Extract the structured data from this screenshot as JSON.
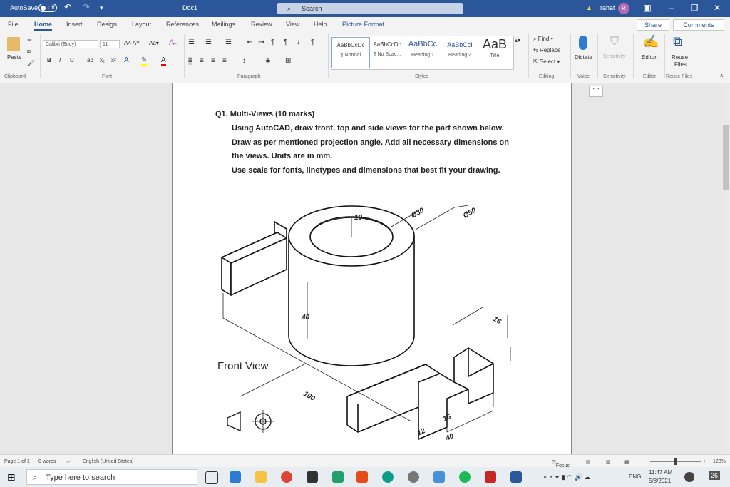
{
  "titlebar": {
    "autosave_label": "AutoSave",
    "autosave_state": "Off",
    "doc_title": "Doc1",
    "search_placeholder": "Search",
    "user_name": "rahaf",
    "user_initial": "R"
  },
  "tabs": [
    "File",
    "Home",
    "Insert",
    "Design",
    "Layout",
    "References",
    "Mailings",
    "Review",
    "View",
    "Help",
    "Picture Format"
  ],
  "share_label": "Share",
  "comments_label": "Comments",
  "ribbon": {
    "clipboard": {
      "paste": "Paste",
      "label": "Clipboard"
    },
    "font": {
      "name": "Calibri (Body)",
      "size": "11",
      "label": "Font",
      "bold": "B",
      "italic": "I",
      "underline": "U"
    },
    "paragraph": {
      "label": "Paragraph"
    },
    "styles": {
      "label": "Styles",
      "items": [
        {
          "preview": "AaBbCcDc",
          "name": "¶ Normal"
        },
        {
          "preview": "AaBbCcDc",
          "name": "¶ No Spac..."
        },
        {
          "preview": "AaBbCc",
          "name": "Heading 1"
        },
        {
          "preview": "AaBbCcI",
          "name": "Heading 2"
        },
        {
          "preview": "AaB",
          "name": "Title"
        }
      ]
    },
    "editing": {
      "find": "Find",
      "replace": "Replace",
      "select": "Select",
      "label": "Editing"
    },
    "voice": {
      "dictate": "Dictate",
      "label": "Voice"
    },
    "sensitivity": {
      "btn": "Sensitivity",
      "label": "Sensitivity"
    },
    "editor": {
      "btn": "Editor",
      "label": "Editor"
    },
    "reuse": {
      "btn1": "Reuse",
      "btn2": "Files",
      "label": "Reuse Files"
    }
  },
  "document": {
    "q_title": "Q1. Multi-Views (10 marks)",
    "lines": [
      "Using AutoCAD, draw front, top and side views for the part shown below.",
      "Draw as per mentioned projection angle. Add all necessary dimensions on",
      "the views. Units are in mm.",
      "Use scale for fonts, linetypes and dimensions that best fit your drawing."
    ],
    "drawing": {
      "dim_bore": "Ø30",
      "dim_outer": "Ø50",
      "dim_wall": "10",
      "dim_height": "40",
      "dim_slot": "16",
      "dim_thick": "12",
      "dim_length": "100",
      "dim_bottom_12": "12",
      "dim_bottom_16": "16",
      "dim_bottom_40": "40",
      "front_view_label": "Front View"
    }
  },
  "status": {
    "page": "Page 1 of 1",
    "words": "0 words",
    "language": "English (United States)",
    "focus": "Focus",
    "zoom": "120%"
  },
  "taskbar": {
    "search_placeholder": "Type here to search",
    "lang": "ENG",
    "time": "11:47 AM",
    "date": "5/8/2021",
    "notif_count": "26"
  }
}
